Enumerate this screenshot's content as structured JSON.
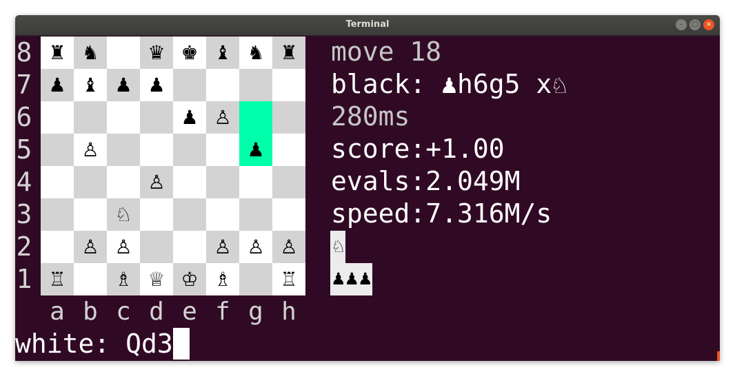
{
  "window": {
    "title": "Terminal",
    "buttons": {
      "minimize": "–",
      "maximize": "□",
      "close": "×"
    }
  },
  "board": {
    "ranks": [
      "8",
      "7",
      "6",
      "5",
      "4",
      "3",
      "2",
      "1"
    ],
    "files": [
      "a",
      "b",
      "c",
      "d",
      "e",
      "f",
      "g",
      "h"
    ],
    "rows": [
      [
        "♜",
        "♞",
        "",
        "♛",
        "♚",
        "♝",
        "♞",
        "♜"
      ],
      [
        "♟",
        "♝",
        "♟",
        "♟",
        "",
        "",
        "",
        ""
      ],
      [
        "",
        "",
        "",
        "",
        "♟",
        "♙",
        "",
        ""
      ],
      [
        "",
        "♙",
        "",
        "",
        "",
        "",
        "♟",
        ""
      ],
      [
        "",
        "",
        "",
        "♙",
        "",
        "",
        "",
        ""
      ],
      [
        "",
        "",
        "♘",
        "",
        "",
        "",
        "",
        ""
      ],
      [
        "",
        "♙",
        "♙",
        "",
        "",
        "♙",
        "♙",
        "♙"
      ],
      [
        "♖",
        "",
        "♗",
        "♕",
        "♔",
        "♗",
        "",
        "♖"
      ]
    ],
    "highlighted_squares": [
      "g6",
      "g5"
    ],
    "colors": {
      "light": "#ffffff",
      "dark": "#d3d3d3",
      "highlight": "#00ffaa"
    }
  },
  "status": {
    "move": "move 18",
    "last_move": "black: ♟h6g5 x♘",
    "time": "280ms",
    "score": "score:+1.00",
    "evals": "evals:2.049M",
    "speed": "speed:7.316M/s"
  },
  "captured": {
    "by_black": "♘",
    "by_white": "♟♟♟"
  },
  "prompt": {
    "text": "white: Qd3"
  }
}
